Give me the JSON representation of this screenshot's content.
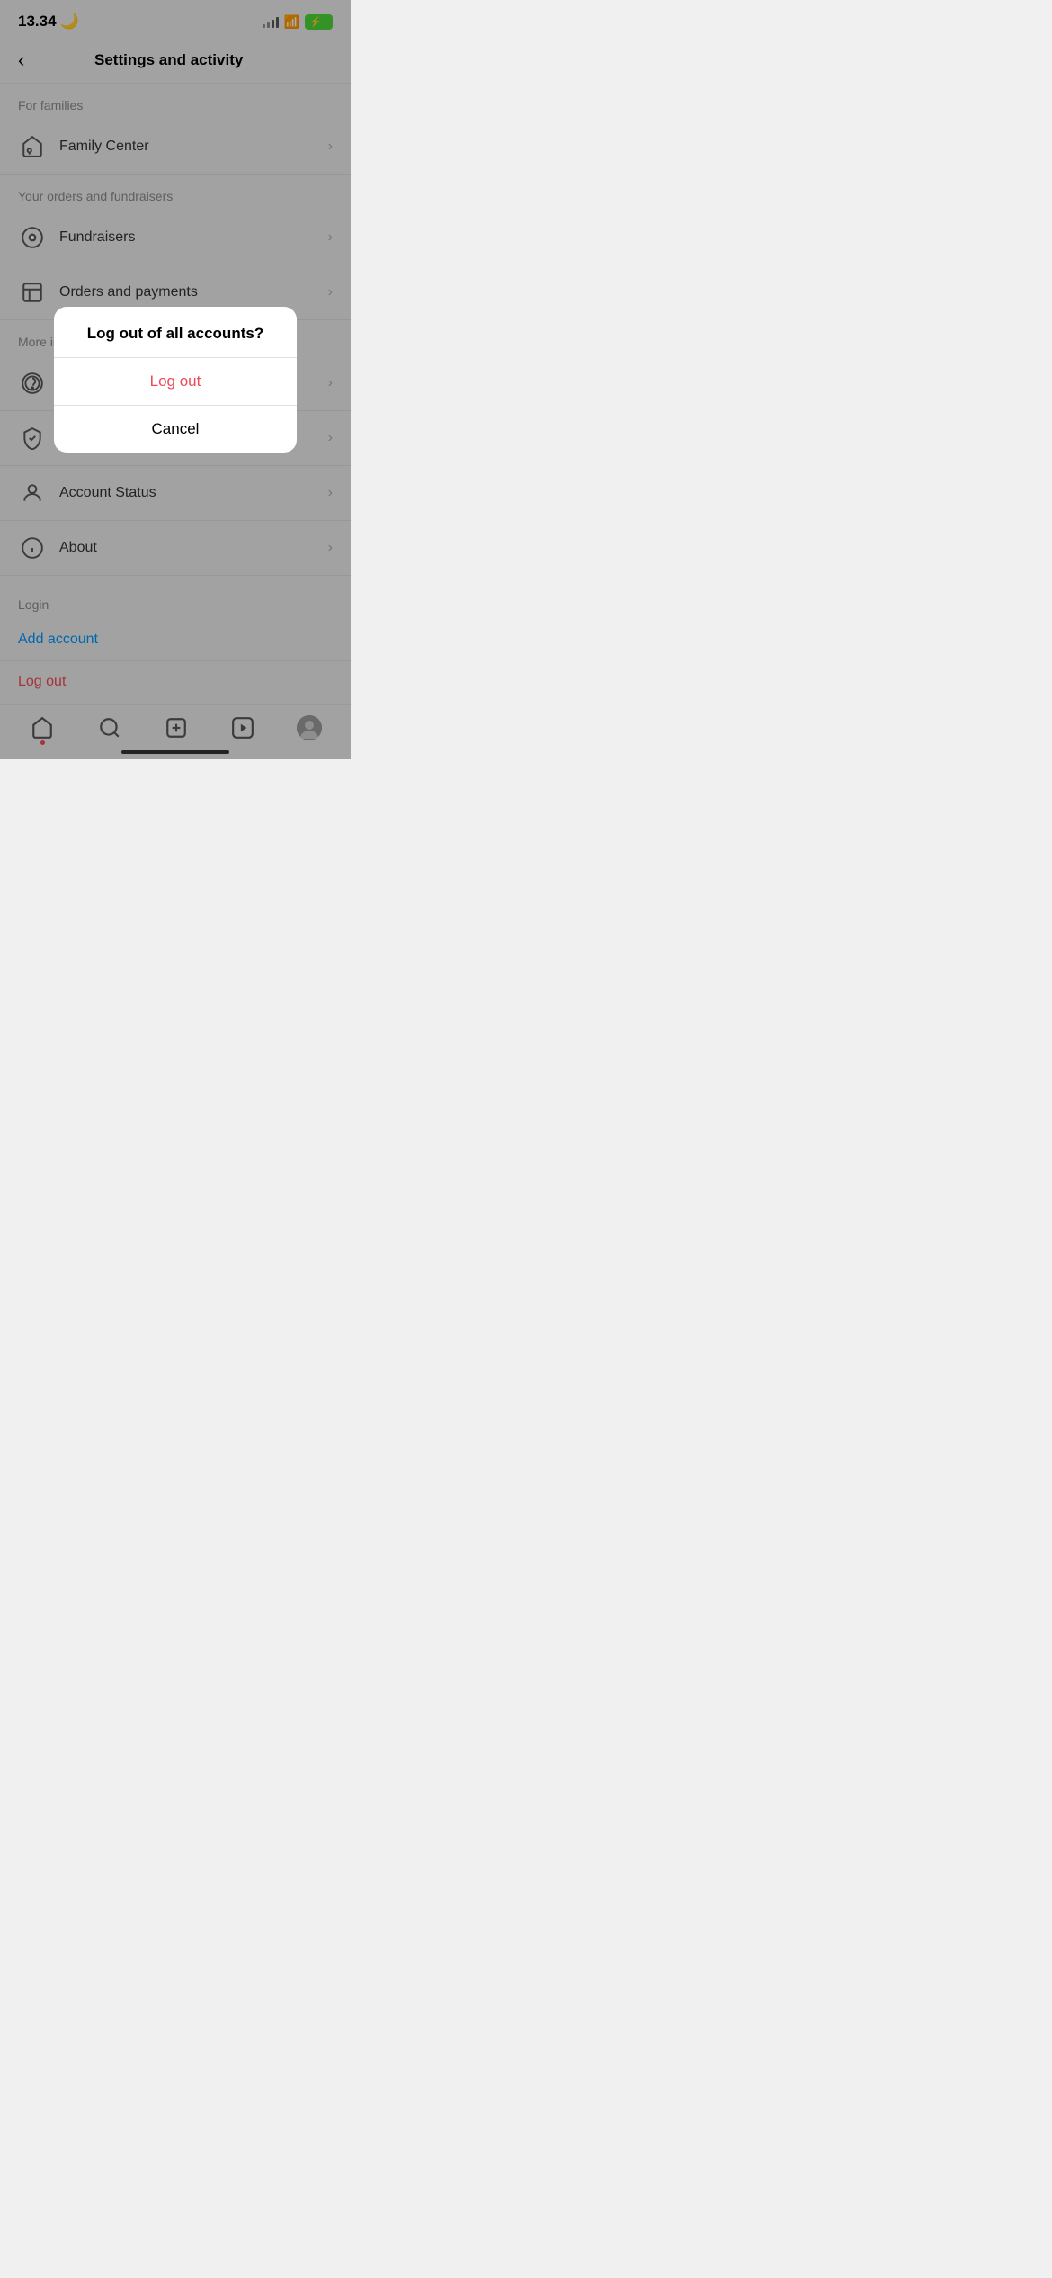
{
  "status_bar": {
    "time": "13.34",
    "moon": "🌙",
    "battery_icon": "⚡"
  },
  "header": {
    "title": "Settings and activity",
    "back_label": "‹"
  },
  "sections": [
    {
      "label": "For families",
      "items": [
        {
          "id": "family-center",
          "text": "Family Center"
        }
      ]
    },
    {
      "label": "Your orders and fundraisers",
      "items": [
        {
          "id": "fundraisers",
          "text": "Fundraisers"
        },
        {
          "id": "orders-payments",
          "text": "Orders and payments"
        }
      ]
    },
    {
      "label": "More info",
      "items": [
        {
          "id": "help",
          "text": "H..."
        },
        {
          "id": "privacy",
          "text": "P..."
        },
        {
          "id": "account-status",
          "text": "Account Status"
        },
        {
          "id": "about",
          "text": "About"
        }
      ]
    }
  ],
  "login_section": {
    "label": "Login",
    "add_account": "Add account",
    "logout": "Log out"
  },
  "modal": {
    "title": "Log out of all accounts?",
    "logout_label": "Log out",
    "cancel_label": "Cancel"
  },
  "bottom_nav": {
    "items": [
      {
        "id": "home",
        "label": "Home"
      },
      {
        "id": "search",
        "label": "Search"
      },
      {
        "id": "new-post",
        "label": "New Post"
      },
      {
        "id": "reels",
        "label": "Reels"
      },
      {
        "id": "profile",
        "label": "Profile"
      }
    ]
  }
}
